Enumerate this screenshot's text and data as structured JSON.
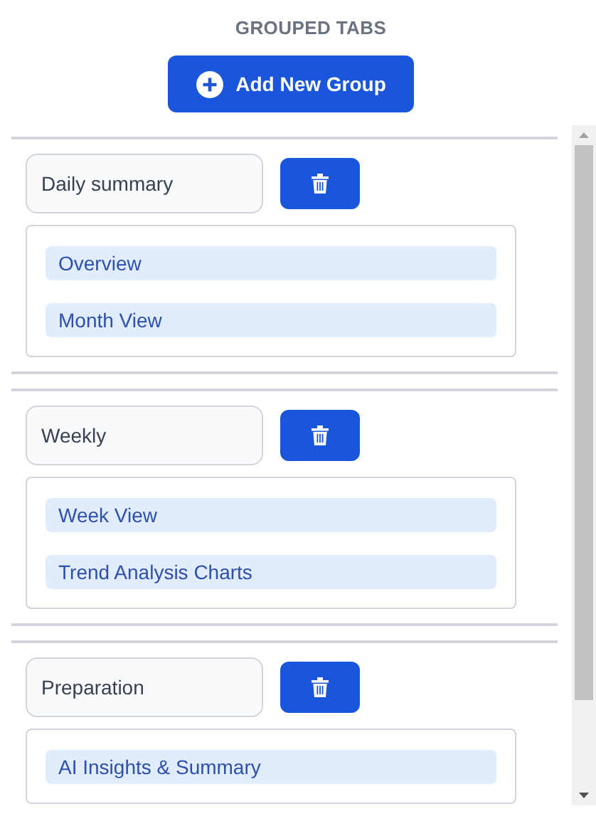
{
  "title": "GROUPED TABS",
  "add_button": {
    "label": "Add New Group"
  },
  "groups": [
    {
      "name": "Daily summary",
      "tabs": [
        {
          "label": "Overview"
        },
        {
          "label": "Month View"
        }
      ]
    },
    {
      "name": "Weekly",
      "tabs": [
        {
          "label": "Week View"
        },
        {
          "label": "Trend Analysis Charts"
        }
      ]
    },
    {
      "name": "Preparation",
      "tabs": [
        {
          "label": "AI Insights & Summary"
        }
      ]
    }
  ]
}
